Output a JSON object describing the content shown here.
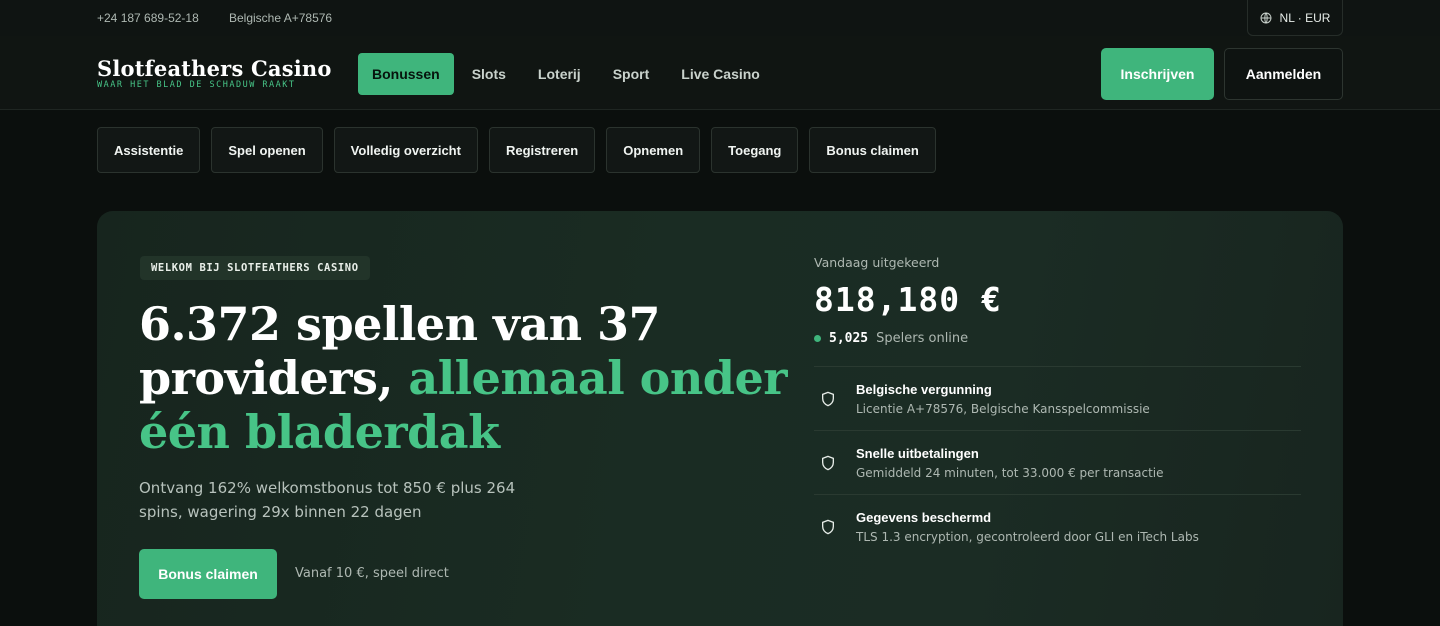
{
  "topbar": {
    "phone": "+24 187 689-52-18",
    "license": "Belgische A+78576",
    "language_currency": "NL · EUR"
  },
  "header": {
    "logo_title": "Slotfeathers Casino",
    "logo_tagline": "WAAR HET BLAD DE SCHADUW RAAKT",
    "nav": [
      {
        "label": "Bonussen",
        "active": true
      },
      {
        "label": "Slots"
      },
      {
        "label": "Loterij"
      },
      {
        "label": "Sport"
      },
      {
        "label": "Live Casino"
      }
    ],
    "signup_label": "Inschrijven",
    "login_label": "Aanmelden"
  },
  "quick_links": [
    "Assistentie",
    "Spel openen",
    "Volledig overzicht",
    "Registreren",
    "Opnemen",
    "Toegang",
    "Bonus claimen"
  ],
  "hero": {
    "badge": "WELKOM BIJ SLOTFEATHERS CASINO",
    "headline_white": "6.372 spellen van 37 providers, ",
    "headline_accent": "allemaal onder één bladerdak",
    "subline": "Ontvang 162% welkomstbonus tot 850 € plus 264 spins, wagering 29x binnen 22 dagen",
    "cta_label": "Bonus claimen",
    "cta_note": "Vanaf 10 €, speel direct"
  },
  "stats": {
    "paid_label": "Vandaag uitgekeerd",
    "paid_value": "818,180 €",
    "online_count": "5,025",
    "online_label": "Spelers online",
    "features": [
      {
        "title": "Belgische vergunning",
        "desc": "Licentie A+78576, Belgische Kansspelcommissie",
        "icon": "shield-icon"
      },
      {
        "title": "Snelle uitbetalingen",
        "desc": "Gemiddeld 24 minuten, tot 33.000 € per transactie",
        "icon": "shield-icon"
      },
      {
        "title": "Gegevens beschermd",
        "desc": "TLS 1.3 encryption, gecontroleerd door GLI en iTech Labs",
        "icon": "shield-icon"
      }
    ]
  },
  "colors": {
    "accent": "#3fb57c",
    "accent_text": "#47c487",
    "background": "#0b0f0d",
    "hero_bg": "#1a2c23"
  }
}
